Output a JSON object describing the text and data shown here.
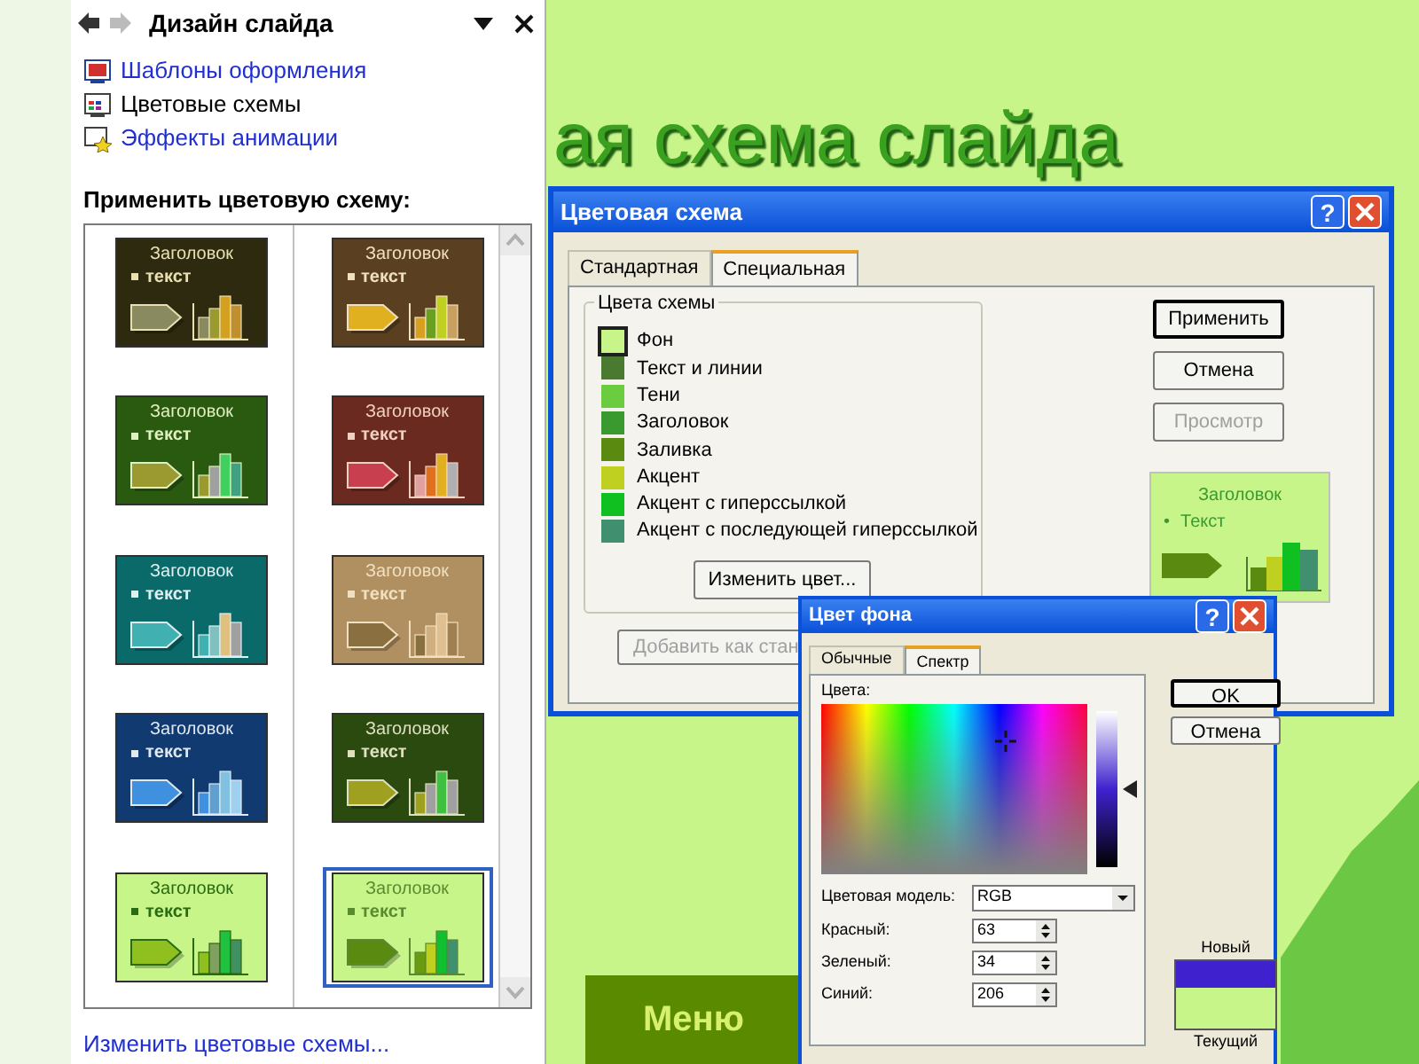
{
  "task_pane": {
    "title": "Дизайн слайда",
    "links": [
      {
        "label": "Шаблоны оформления",
        "kind": "templates",
        "selected": false
      },
      {
        "label": "Цветовые схемы",
        "kind": "colors",
        "selected": true
      },
      {
        "label": "Эффекты анимации",
        "kind": "animation",
        "selected": false
      }
    ],
    "section_title": "Применить цветовую схему:",
    "schemes": [
      {
        "title": "Заголовок",
        "text": "текст",
        "color": "#2e2a10",
        "palette": [
          {
            "color": "#e8e0b0"
          },
          {
            "color": "#8a8a60"
          },
          {
            "color": "#8a8a60"
          },
          {
            "color": "#9a9a30"
          },
          {
            "color": "#d4a020"
          },
          {
            "color": "#c09030"
          }
        ],
        "selected": false
      },
      {
        "title": "Заголовок",
        "text": "текст",
        "color": "#5a4020",
        "palette": [
          {
            "color": "#f0e0c0"
          },
          {
            "color": "#e0b020"
          },
          {
            "color": "#d8a020"
          },
          {
            "color": "#6aa020"
          },
          {
            "color": "#c0d020"
          },
          {
            "color": "#c8a060"
          }
        ],
        "selected": false
      },
      {
        "title": "Заголовок",
        "text": "текст",
        "color": "#2a5a10",
        "palette": [
          {
            "color": "#e0f0c0"
          },
          {
            "color": "#9a9a30"
          },
          {
            "color": "#9a9a30"
          },
          {
            "color": "#a0a0a0"
          },
          {
            "color": "#40d060"
          },
          {
            "color": "#40a080"
          }
        ],
        "selected": false
      },
      {
        "title": "Заголовок",
        "text": "текст",
        "color": "#6a2a20",
        "palette": [
          {
            "color": "#f0d0c0"
          },
          {
            "color": "#c84050"
          },
          {
            "color": "#e0a0a0"
          },
          {
            "color": "#e07020"
          },
          {
            "color": "#e0b020"
          },
          {
            "color": "#b0b0b0"
          }
        ],
        "selected": false
      },
      {
        "title": "Заголовок",
        "text": "текст",
        "color": "#0a6a6a",
        "palette": [
          {
            "color": "#e0f0f0"
          },
          {
            "color": "#40b0b0"
          },
          {
            "color": "#40b0b0"
          },
          {
            "color": "#80c0c0"
          },
          {
            "color": "#e0c080"
          },
          {
            "color": "#a0a0a0"
          }
        ],
        "selected": false
      },
      {
        "title": "Заголовок",
        "text": "текст",
        "color": "#b09060",
        "palette": [
          {
            "color": "#f0e0c0"
          },
          {
            "color": "#8a7040"
          },
          {
            "color": "#8a7040"
          },
          {
            "color": "#d0b080"
          },
          {
            "color": "#e0c090"
          },
          {
            "color": "#a08050"
          }
        ],
        "selected": false
      },
      {
        "title": "Заголовок",
        "text": "текст",
        "color": "#103a70",
        "palette": [
          {
            "color": "#e0e8f0"
          },
          {
            "color": "#4090e0"
          },
          {
            "color": "#4090e0"
          },
          {
            "color": "#60a0d0"
          },
          {
            "color": "#80c0e0"
          },
          {
            "color": "#a0d0f0"
          }
        ],
        "selected": false
      },
      {
        "title": "Заголовок",
        "text": "текст",
        "color": "#2a4a10",
        "palette": [
          {
            "color": "#e0e0c0"
          },
          {
            "color": "#a0a020"
          },
          {
            "color": "#a0a020"
          },
          {
            "color": "#a0a0a0"
          },
          {
            "color": "#40c040"
          },
          {
            "color": "#a0a0a0"
          }
        ],
        "selected": false
      },
      {
        "title": "Заголовок",
        "text": "текст",
        "color": "#c8f58a",
        "palette": [
          {
            "color": "#2a6a10"
          },
          {
            "color": "#90c020"
          },
          {
            "color": "#90c020"
          },
          {
            "color": "#80a060"
          },
          {
            "color": "#20c040"
          },
          {
            "color": "#409060"
          }
        ],
        "selected": false
      },
      {
        "title": "Заголовок",
        "text": "текст",
        "color": "#c8f58a",
        "palette": [
          {
            "color": "#5a8a30"
          },
          {
            "color": "#5a8a10"
          },
          {
            "color": "#6a9a10"
          },
          {
            "color": "#c0d020"
          },
          {
            "color": "#10c030"
          },
          {
            "color": "#409070"
          }
        ],
        "selected": true
      }
    ],
    "footer_link": "Изменить цветовые схемы..."
  },
  "slide": {
    "title": "ая схема слайда",
    "menu_button": "Меню"
  },
  "scheme_dialog": {
    "title": "Цветовая схема",
    "help": "?",
    "tabs": [
      {
        "label": "Стандартная",
        "selected": false
      },
      {
        "label": "Специальная",
        "selected": true
      }
    ],
    "group_title": "Цвета схемы",
    "colors": [
      {
        "label": "Фон",
        "color": "#c8f58a",
        "selected": true
      },
      {
        "label": "Текст и линии",
        "color": "#4a7a30",
        "selected": false
      },
      {
        "label": "Тени",
        "color": "#6ccc40",
        "selected": false
      },
      {
        "label": "Заголовок",
        "color": "#3a9a30",
        "selected": false
      },
      {
        "label": "Заливка",
        "color": "#5a8a10",
        "selected": false
      },
      {
        "label": "Акцент",
        "color": "#c0d020",
        "selected": false
      },
      {
        "label": "Акцент с гиперссылкой",
        "color": "#10c020",
        "selected": false
      },
      {
        "label": "Акцент с последующей гиперссылкой",
        "color": "#409070",
        "selected": false
      }
    ],
    "change_button": "Изменить цвет...",
    "add_button": {
      "label": "Добавить как стан",
      "disabled": true
    },
    "buttons": [
      {
        "label": "Применить",
        "disabled": false
      },
      {
        "label": "Отмена",
        "disabled": false
      },
      {
        "label": "Просмотр",
        "disabled": true
      }
    ],
    "preview": {
      "title": "Заголовок",
      "bullet": "•",
      "text": "Текст"
    }
  },
  "color_dialog": {
    "title": "Цвет фона",
    "help": "?",
    "tabs": [
      {
        "label": "Обычные",
        "selected": false
      },
      {
        "label": "Спектр",
        "selected": true
      }
    ],
    "colors_label": "Цвета:",
    "luminance": {
      "level": 0.5
    },
    "model_label": "Цветовая модель:",
    "model_value": "RGB",
    "fields": [
      {
        "label": "Красный:",
        "value": "63"
      },
      {
        "label": "Зеленый:",
        "value": "34"
      },
      {
        "label": "Синий:",
        "value": "206"
      }
    ],
    "buttons": [
      "OK",
      "Отмена"
    ],
    "new": {
      "label": "Новый",
      "color": "#3f22ce"
    },
    "current": {
      "label": "Текущий",
      "color": "#c8f58a"
    }
  }
}
